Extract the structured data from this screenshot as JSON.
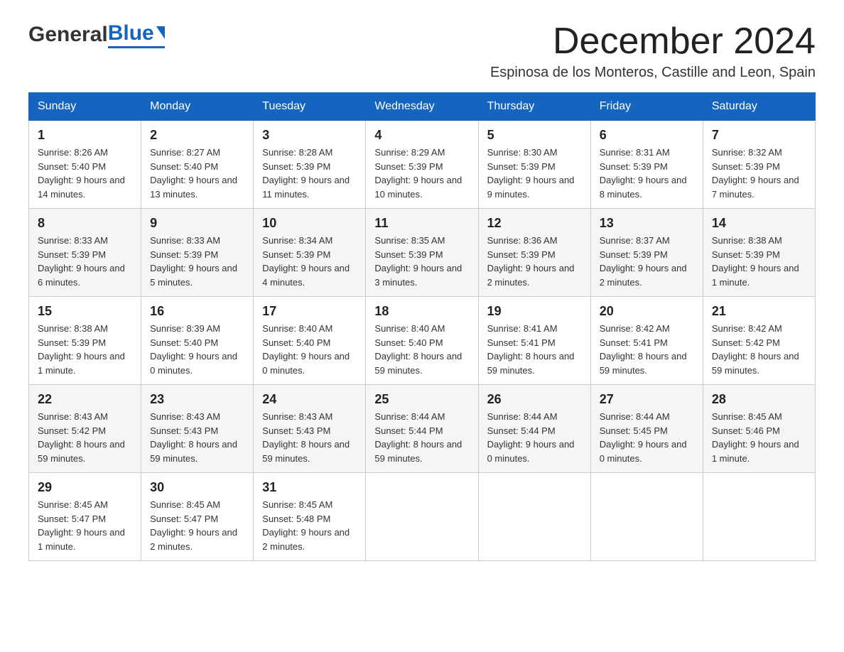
{
  "header": {
    "logo_general": "General",
    "logo_blue": "Blue",
    "month_title": "December 2024",
    "location": "Espinosa de los Monteros, Castille and Leon, Spain"
  },
  "days_of_week": [
    "Sunday",
    "Monday",
    "Tuesday",
    "Wednesday",
    "Thursday",
    "Friday",
    "Saturday"
  ],
  "weeks": [
    [
      {
        "day": "1",
        "sunrise": "8:26 AM",
        "sunset": "5:40 PM",
        "daylight": "9 hours and 14 minutes."
      },
      {
        "day": "2",
        "sunrise": "8:27 AM",
        "sunset": "5:40 PM",
        "daylight": "9 hours and 13 minutes."
      },
      {
        "day": "3",
        "sunrise": "8:28 AM",
        "sunset": "5:39 PM",
        "daylight": "9 hours and 11 minutes."
      },
      {
        "day": "4",
        "sunrise": "8:29 AM",
        "sunset": "5:39 PM",
        "daylight": "9 hours and 10 minutes."
      },
      {
        "day": "5",
        "sunrise": "8:30 AM",
        "sunset": "5:39 PM",
        "daylight": "9 hours and 9 minutes."
      },
      {
        "day": "6",
        "sunrise": "8:31 AM",
        "sunset": "5:39 PM",
        "daylight": "9 hours and 8 minutes."
      },
      {
        "day": "7",
        "sunrise": "8:32 AM",
        "sunset": "5:39 PM",
        "daylight": "9 hours and 7 minutes."
      }
    ],
    [
      {
        "day": "8",
        "sunrise": "8:33 AM",
        "sunset": "5:39 PM",
        "daylight": "9 hours and 6 minutes."
      },
      {
        "day": "9",
        "sunrise": "8:33 AM",
        "sunset": "5:39 PM",
        "daylight": "9 hours and 5 minutes."
      },
      {
        "day": "10",
        "sunrise": "8:34 AM",
        "sunset": "5:39 PM",
        "daylight": "9 hours and 4 minutes."
      },
      {
        "day": "11",
        "sunrise": "8:35 AM",
        "sunset": "5:39 PM",
        "daylight": "9 hours and 3 minutes."
      },
      {
        "day": "12",
        "sunrise": "8:36 AM",
        "sunset": "5:39 PM",
        "daylight": "9 hours and 2 minutes."
      },
      {
        "day": "13",
        "sunrise": "8:37 AM",
        "sunset": "5:39 PM",
        "daylight": "9 hours and 2 minutes."
      },
      {
        "day": "14",
        "sunrise": "8:38 AM",
        "sunset": "5:39 PM",
        "daylight": "9 hours and 1 minute."
      }
    ],
    [
      {
        "day": "15",
        "sunrise": "8:38 AM",
        "sunset": "5:39 PM",
        "daylight": "9 hours and 1 minute."
      },
      {
        "day": "16",
        "sunrise": "8:39 AM",
        "sunset": "5:40 PM",
        "daylight": "9 hours and 0 minutes."
      },
      {
        "day": "17",
        "sunrise": "8:40 AM",
        "sunset": "5:40 PM",
        "daylight": "9 hours and 0 minutes."
      },
      {
        "day": "18",
        "sunrise": "8:40 AM",
        "sunset": "5:40 PM",
        "daylight": "8 hours and 59 minutes."
      },
      {
        "day": "19",
        "sunrise": "8:41 AM",
        "sunset": "5:41 PM",
        "daylight": "8 hours and 59 minutes."
      },
      {
        "day": "20",
        "sunrise": "8:42 AM",
        "sunset": "5:41 PM",
        "daylight": "8 hours and 59 minutes."
      },
      {
        "day": "21",
        "sunrise": "8:42 AM",
        "sunset": "5:42 PM",
        "daylight": "8 hours and 59 minutes."
      }
    ],
    [
      {
        "day": "22",
        "sunrise": "8:43 AM",
        "sunset": "5:42 PM",
        "daylight": "8 hours and 59 minutes."
      },
      {
        "day": "23",
        "sunrise": "8:43 AM",
        "sunset": "5:43 PM",
        "daylight": "8 hours and 59 minutes."
      },
      {
        "day": "24",
        "sunrise": "8:43 AM",
        "sunset": "5:43 PM",
        "daylight": "8 hours and 59 minutes."
      },
      {
        "day": "25",
        "sunrise": "8:44 AM",
        "sunset": "5:44 PM",
        "daylight": "8 hours and 59 minutes."
      },
      {
        "day": "26",
        "sunrise": "8:44 AM",
        "sunset": "5:44 PM",
        "daylight": "9 hours and 0 minutes."
      },
      {
        "day": "27",
        "sunrise": "8:44 AM",
        "sunset": "5:45 PM",
        "daylight": "9 hours and 0 minutes."
      },
      {
        "day": "28",
        "sunrise": "8:45 AM",
        "sunset": "5:46 PM",
        "daylight": "9 hours and 1 minute."
      }
    ],
    [
      {
        "day": "29",
        "sunrise": "8:45 AM",
        "sunset": "5:47 PM",
        "daylight": "9 hours and 1 minute."
      },
      {
        "day": "30",
        "sunrise": "8:45 AM",
        "sunset": "5:47 PM",
        "daylight": "9 hours and 2 minutes."
      },
      {
        "day": "31",
        "sunrise": "8:45 AM",
        "sunset": "5:48 PM",
        "daylight": "9 hours and 2 minutes."
      },
      null,
      null,
      null,
      null
    ]
  ]
}
